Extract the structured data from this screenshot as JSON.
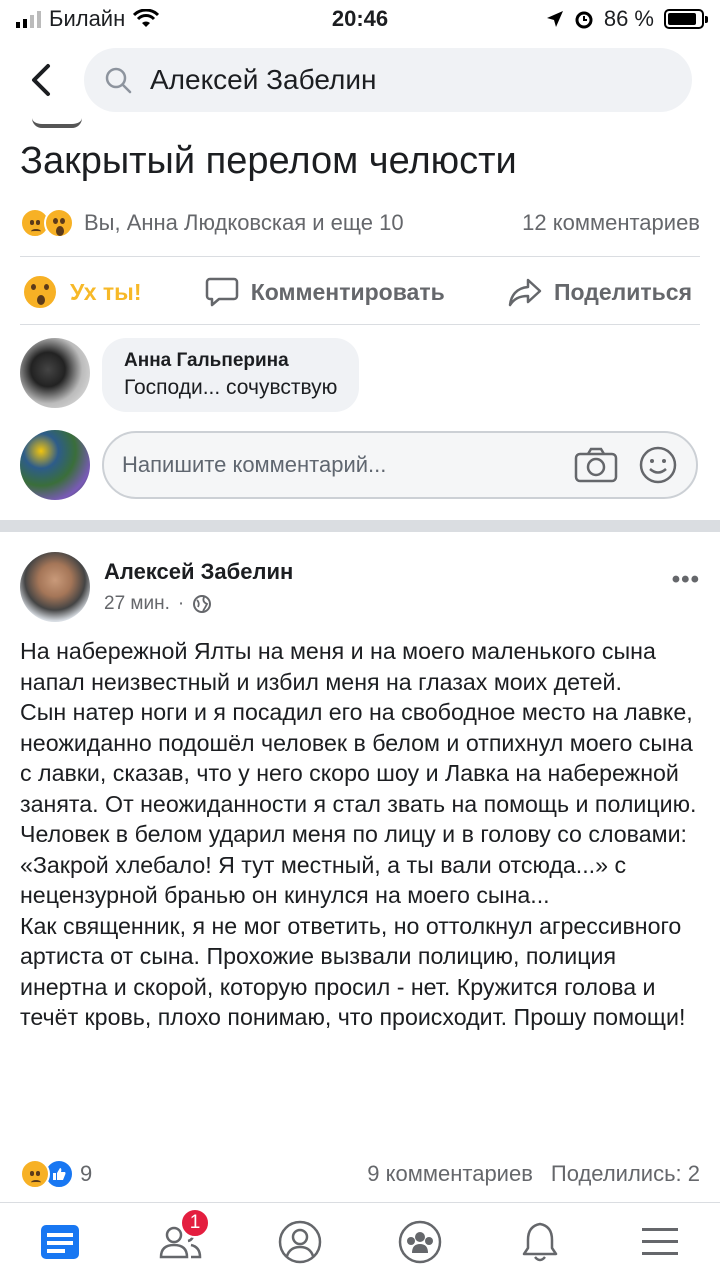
{
  "status_bar": {
    "carrier": "Билайн",
    "time": "20:46",
    "battery": "86 %"
  },
  "search": {
    "query": "Алексей Забелин"
  },
  "post1": {
    "title": "Закрытый перелом челюсти",
    "reactions_text": "Вы, Анна Людковская и еще 10",
    "comments_count": "12 комментариев",
    "actions": {
      "reaction": "Ух ты!",
      "comment": "Комментировать",
      "share": "Поделиться"
    },
    "comment": {
      "author": "Анна Гальперина",
      "text": "Господи... сочувствую"
    },
    "write_placeholder": "Напишите комментарий..."
  },
  "post2": {
    "author": "Алексей Забелин",
    "time": "27 мин.",
    "dot": "·",
    "more": "•••",
    "body": "На набережной Ялты на меня и на моего маленького сына напал неизвестный и избил меня на глазах моих детей.\nСын натер ноги и я посадил его на свободное место на лавке, неожиданно подошёл человек в белом и отпихнул моего сына с лавки, сказав, что у него скоро шоу и Лавка на набережной занята. От неожиданности я стал звать на помощь и полицию. Человек в белом ударил меня по лицу и в голову со словами: «Закрой хлебало! Я тут местный, а ты вали отсюда...» с нецензурной бранью он кинулся на моего сына...\nКак священник, я не мог ответить, но оттолкнул агрессивного артиста от сына. Прохожие вызвали полицию, полиция инертна и скорой, которую просил - нет. Кружится голова и течёт кровь, плохо понимаю, что происходит. Прошу помощи!",
    "reactions_count": "9",
    "comments": "9 комментариев",
    "shares": "Поделились: 2"
  },
  "tabbar": {
    "friends_badge": "1"
  },
  "colors": {
    "accent": "#1877f2",
    "wow": "#f7b928",
    "badge": "#e41e3f"
  }
}
